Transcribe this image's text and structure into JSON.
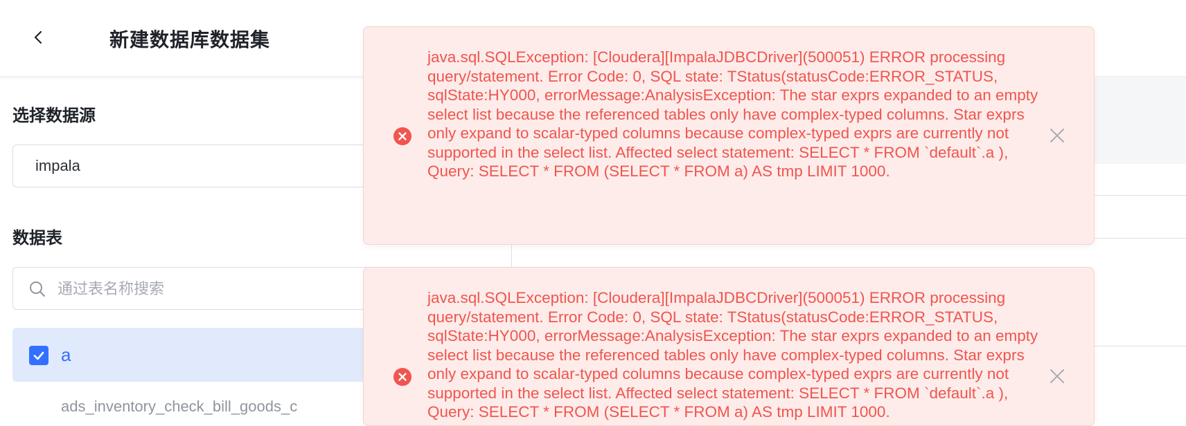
{
  "header": {
    "title": "新建数据库数据集"
  },
  "datasource": {
    "label": "选择数据源",
    "selected": "impala"
  },
  "tables": {
    "label": "数据表",
    "search_placeholder": "通过表名称搜索",
    "items": [
      {
        "name": "a",
        "checked": true
      },
      {
        "name": "ads_inventory_check_bill_goods_c"
      }
    ]
  },
  "toasts": [
    {
      "type": "error",
      "message": "java.sql.SQLException: [Cloudera][ImpalaJDBCDriver](500051) ERROR processing query/statement. Error Code: 0, SQL state: TStatus(statusCode:ERROR_STATUS, sqlState:HY000, errorMessage:AnalysisException: The star exprs expanded to an empty select list because the referenced tables only have complex-typed columns. Star exprs only expand to scalar-typed columns because complex-typed exprs are currently not supported in the select list. Affected select statement: SELECT * FROM `default`.a ), Query: SELECT * FROM (SELECT * FROM a) AS tmp LIMIT 1000."
    },
    {
      "type": "error",
      "message": "java.sql.SQLException: [Cloudera][ImpalaJDBCDriver](500051) ERROR processing query/statement. Error Code: 0, SQL state: TStatus(statusCode:ERROR_STATUS, sqlState:HY000, errorMessage:AnalysisException: The star exprs expanded to an empty select list because the referenced tables only have complex-typed columns. Star exprs only expand to scalar-typed columns because complex-typed exprs are currently not supported in the select list. Affected select statement: SELECT * FROM `default`.a ), Query: SELECT * FROM (SELECT * FROM a) AS tmp LIMIT 1000."
    }
  ],
  "colors": {
    "accent": "#3370ff",
    "error_text": "#f0554e",
    "error_bg": "#fdecea",
    "selected_bg": "#e1eafc"
  },
  "icons": {
    "back": "chevron-left-icon",
    "search": "search-icon",
    "checkbox": "checkmark-icon",
    "error": "error-circle-icon",
    "close": "close-icon"
  }
}
